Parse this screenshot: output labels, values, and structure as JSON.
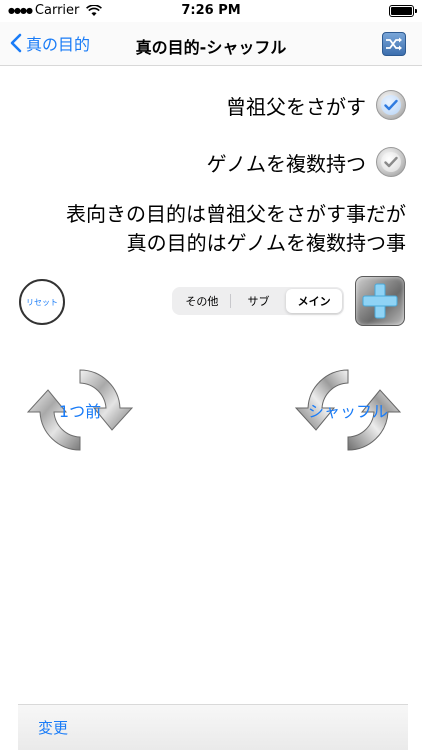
{
  "status_bar": {
    "carrier": "Carrier",
    "time": "7:26 PM"
  },
  "nav": {
    "back_label": "真の目的",
    "title": "真の目的-シャッフル"
  },
  "options": [
    {
      "label": "曾祖父をさがす",
      "checked_style": "blue"
    },
    {
      "label": "ゲノムを複数持つ",
      "checked_style": "gray"
    }
  ],
  "description": {
    "line1": "表向きの目的は曾祖父をさがす事だが",
    "line2": "真の目的はゲノムを複数持つ事"
  },
  "controls": {
    "reset_label": "リセット",
    "segments": [
      "その他",
      "サブ",
      "メイン"
    ],
    "selected_segment": "メイン"
  },
  "actions": {
    "previous_label": "1つ前",
    "shuffle_label": "シャッフル"
  },
  "toolbar": {
    "change_label": "変更"
  },
  "colors": {
    "accent": "#1a7cf7",
    "plus": "#8fd3f5"
  }
}
